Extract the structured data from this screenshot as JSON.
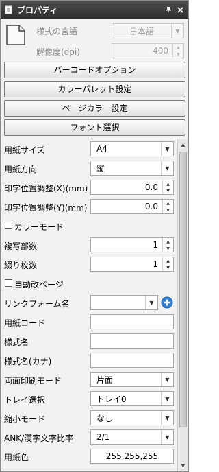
{
  "window": {
    "title": "プロパティ",
    "pin_icon": "pin-icon",
    "close_icon": "close-icon"
  },
  "header": {
    "style_language_label": "様式の言語",
    "style_language_value": "日本語",
    "resolution_label": "解像度(dpi)",
    "resolution_value": "400"
  },
  "buttons": {
    "barcode_options": "バーコードオプション",
    "color_palette": "カラーパレット設定",
    "page_color": "ページカラー設定",
    "font_select": "フォント選択"
  },
  "properties": {
    "paper_size_label": "用紙サイズ",
    "paper_size_value": "A4",
    "paper_orientation_label": "用紙方向",
    "paper_orientation_value": "縦",
    "print_offset_x_label": "印字位置調整(X)(mm)",
    "print_offset_x_value": "0.0",
    "print_offset_y_label": "印字位置調整(Y)(mm)",
    "print_offset_y_value": "0.0",
    "color_mode_label": "カラーモード",
    "color_mode_checked": false,
    "copies_label": "複写部数",
    "copies_value": "1",
    "binding_sheets_label": "綴り枚数",
    "binding_sheets_value": "1",
    "auto_page_break_label": "自動改ページ",
    "auto_page_break_checked": false,
    "link_form_label": "リンクフォーム名",
    "link_form_value": "",
    "paper_code_label": "用紙コード",
    "paper_code_value": "",
    "form_name_label": "様式名",
    "form_name_value": "",
    "form_name_kana_label": "様式名(カナ)",
    "form_name_kana_value": "",
    "duplex_mode_label": "両面印刷モード",
    "duplex_mode_value": "片面",
    "tray_label": "トレイ選択",
    "tray_value": "トレイ0",
    "shrink_mode_label": "縮小モード",
    "shrink_mode_value": "なし",
    "ank_kanji_ratio_label": "ANK/漢字文字比率",
    "ank_kanji_ratio_value": "2/1",
    "paper_color_label": "用紙色",
    "paper_color_value": "255,255,255"
  },
  "colors": {
    "titlebar": "#3a3a3a",
    "add_icon": "#2f7fd3"
  }
}
